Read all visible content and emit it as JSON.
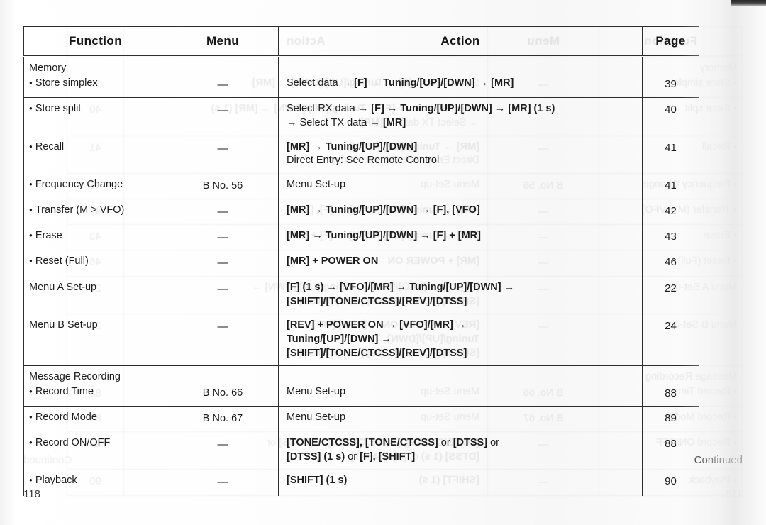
{
  "page": {
    "folio": "118",
    "continued_label": "Continued"
  },
  "table": {
    "headers": {
      "function": "Function",
      "menu": "Menu",
      "action": "Action",
      "page": "Page"
    },
    "em_dash": "—",
    "sections": [
      {
        "title": "Memory",
        "rows": [
          {
            "function": "Store simplex",
            "bulleted": true,
            "menu": "—",
            "action_lines": [
              [
                {
                  "t": "Select data ",
                  "b": false
                },
                {
                  "t": "→ ",
                  "b": false
                },
                {
                  "t": "[F]",
                  "b": true
                },
                {
                  "t": " → ",
                  "b": false
                },
                {
                  "t": "Tuning/[UP]/[DWN]",
                  "b": true
                },
                {
                  "t": " → ",
                  "b": false
                },
                {
                  "t": "[MR]",
                  "b": true
                }
              ]
            ],
            "page": "39"
          },
          {
            "function": "Store split",
            "bulleted": true,
            "menu": "—",
            "action_lines": [
              [
                {
                  "t": "Select RX data ",
                  "b": false
                },
                {
                  "t": "→ ",
                  "b": false
                },
                {
                  "t": "[F]",
                  "b": true
                },
                {
                  "t": " → ",
                  "b": false
                },
                {
                  "t": "Tuning/[UP]/[DWN]",
                  "b": true
                },
                {
                  "t": " → ",
                  "b": false
                },
                {
                  "t": "[MR] (1 s)",
                  "b": true
                }
              ],
              [
                {
                  "t": "→ Select TX data → ",
                  "b": false
                },
                {
                  "t": "[MR]",
                  "b": true
                }
              ]
            ],
            "page": "40"
          },
          {
            "function": "Recall",
            "bulleted": true,
            "menu": "—",
            "action_lines": [
              [
                {
                  "t": "[MR]",
                  "b": true
                },
                {
                  "t": " → ",
                  "b": false
                },
                {
                  "t": "Tuning/[UP]/[DWN]",
                  "b": true
                }
              ],
              [
                {
                  "t": "Direct Entry: See Remote Control",
                  "b": false
                }
              ]
            ],
            "page": "41"
          },
          {
            "function": "Frequency Change",
            "bulleted": true,
            "menu": "B No. 56",
            "action_lines": [
              [
                {
                  "t": "Menu Set-up",
                  "b": false
                }
              ]
            ],
            "page": "41"
          },
          {
            "function": "Transfer (M > VFO)",
            "bulleted": true,
            "menu": "—",
            "action_lines": [
              [
                {
                  "t": "[MR]",
                  "b": true
                },
                {
                  "t": " → ",
                  "b": false
                },
                {
                  "t": "Tuning/[UP]/[DWN]",
                  "b": true
                },
                {
                  "t": " → ",
                  "b": false
                },
                {
                  "t": "[F], [VFO]",
                  "b": true
                }
              ]
            ],
            "page": "42"
          },
          {
            "function": "Erase",
            "bulleted": true,
            "menu": "—",
            "action_lines": [
              [
                {
                  "t": "[MR]",
                  "b": true
                },
                {
                  "t": " → ",
                  "b": false
                },
                {
                  "t": "Tuning/[UP]/[DWN]",
                  "b": true
                },
                {
                  "t": " → ",
                  "b": false
                },
                {
                  "t": "[F] + [MR]",
                  "b": true
                }
              ]
            ],
            "page": "43"
          },
          {
            "function": "Reset (Full)",
            "bulleted": true,
            "menu": "—",
            "action_lines": [
              [
                {
                  "t": "[MR] + POWER ON",
                  "b": true
                }
              ]
            ],
            "page": "46"
          }
        ]
      },
      {
        "title": null,
        "rows": [
          {
            "function": "Menu A Set-up",
            "bulleted": false,
            "menu": "—",
            "action_lines": [
              [
                {
                  "t": "[F] (1 s)",
                  "b": true
                },
                {
                  "t": " → ",
                  "b": false
                },
                {
                  "t": "[VFO]/[MR]",
                  "b": true
                },
                {
                  "t": " → ",
                  "b": false
                },
                {
                  "t": "Tuning/[UP]/[DWN]",
                  "b": true
                },
                {
                  "t": " →",
                  "b": false
                }
              ],
              [
                {
                  "t": "[SHIFT]/[TONE/CTCSS]/[REV]/[DTSS]",
                  "b": true
                }
              ]
            ],
            "page": "22"
          }
        ]
      },
      {
        "title": null,
        "rows": [
          {
            "function": "Menu B Set-up",
            "bulleted": false,
            "menu": "—",
            "action_lines": [
              [
                {
                  "t": "[REV] + POWER ON",
                  "b": true
                },
                {
                  "t": " → ",
                  "b": false
                },
                {
                  "t": "[VFO]/[MR]",
                  "b": true
                },
                {
                  "t": " →",
                  "b": false
                }
              ],
              [
                {
                  "t": "Tuning/[UP]/[DWN]",
                  "b": true
                },
                {
                  "t": " →",
                  "b": false
                }
              ],
              [
                {
                  "t": "[SHIFT]/[TONE/CTCSS]/[REV]/[DTSS]",
                  "b": true
                }
              ]
            ],
            "page": "24"
          }
        ]
      },
      {
        "title": "Message Recording",
        "rows": [
          {
            "function": "Record Time",
            "bulleted": true,
            "menu": "B No. 66",
            "action_lines": [
              [
                {
                  "t": "Menu Set-up",
                  "b": false
                }
              ]
            ],
            "page": "88"
          },
          {
            "function": "Record Mode",
            "bulleted": true,
            "menu": "B No. 67",
            "action_lines": [
              [
                {
                  "t": "Menu Set-up",
                  "b": false
                }
              ]
            ],
            "page": "89"
          },
          {
            "function": "Record ON/OFF",
            "bulleted": true,
            "menu": "—",
            "action_lines": [
              [
                {
                  "t": "[TONE/CTCSS], [TONE/CTCSS]",
                  "b": true
                },
                {
                  "t": " or ",
                  "b": false
                },
                {
                  "t": "[DTSS]",
                  "b": true
                },
                {
                  "t": " or",
                  "b": false
                }
              ],
              [
                {
                  "t": "[DTSS] (1 s)",
                  "b": true
                },
                {
                  "t": " or ",
                  "b": false
                },
                {
                  "t": "[F], [SHIFT]",
                  "b": true
                }
              ]
            ],
            "page": "88"
          },
          {
            "function": "Playback",
            "bulleted": true,
            "menu": "—",
            "action_lines": [
              [
                {
                  "t": "[SHIFT] (1 s)",
                  "b": true
                }
              ]
            ],
            "page": "90"
          }
        ]
      }
    ]
  }
}
